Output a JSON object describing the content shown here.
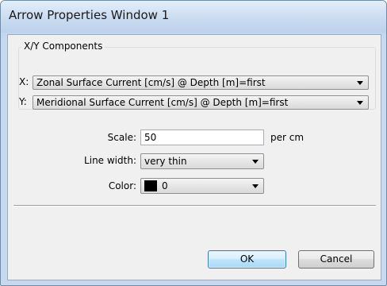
{
  "window": {
    "title": "Arrow Properties Window 1"
  },
  "components": {
    "group_label": "X/Y Components",
    "x_label": "X:",
    "x_value": "Zonal Surface Current [cm/s] @ Depth [m]=first",
    "y_label": "Y:",
    "y_value": "Meridional Surface Current [cm/s] @ Depth [m]=first"
  },
  "scale": {
    "label": "Scale:",
    "value": "50",
    "unit": "per cm"
  },
  "line_width": {
    "label": "Line width:",
    "value": "very thin"
  },
  "color": {
    "label": "Color:",
    "value": "0",
    "swatch": "#000000"
  },
  "buttons": {
    "ok": "OK",
    "cancel": "Cancel"
  }
}
